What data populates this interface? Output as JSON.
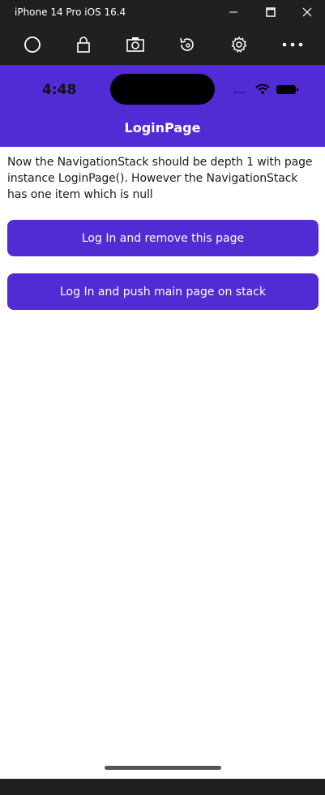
{
  "window": {
    "title": "iPhone 14 Pro iOS 16.4",
    "minimize_icon": "minimize-icon",
    "maximize_icon": "maximize-icon",
    "close_icon": "close-icon"
  },
  "toolbar": {
    "icons": [
      "home-circle-icon",
      "lock-icon",
      "camera-icon",
      "rotate-icon",
      "settings-gear-icon",
      "more-dots-icon"
    ]
  },
  "status_bar": {
    "time": "4:48"
  },
  "nav": {
    "title": "LoginPage"
  },
  "content": {
    "message": "Now the NavigationStack should be depth 1 with page instance LoginPage(). However the NavigationStack has one item which is null",
    "button_remove": "Log In and remove this page",
    "button_push": "Log In and push main page on stack"
  },
  "colors": {
    "accent": "#512bd4",
    "chrome": "#202020"
  }
}
